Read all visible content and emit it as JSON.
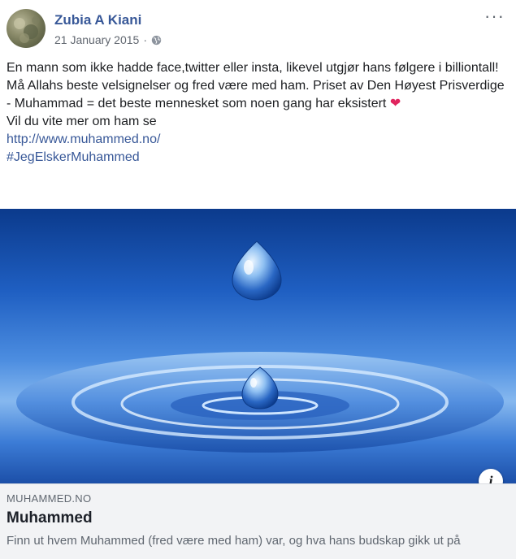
{
  "post": {
    "author": "Zubia A Kiani",
    "date": "21 January 2015",
    "separator": "·",
    "privacy_icon": "globe-icon",
    "more_icon": "more-options-icon",
    "text_line1": "En mann som ikke hadde face,twitter eller insta, likevel utgjør hans følgere i billiontall! Må Allahs beste velsignelser og fred være med ham. Priset av Den Høyest Prisverdige - Muhammad = det beste mennesket som noen gang har eksistert",
    "heart": "❤",
    "text_line2": "Vil du vite mer om ham se",
    "link": "http://www.muhammed.no/",
    "hashtag": "#JegElskerMuhammed"
  },
  "link_card": {
    "image_desc_icon": "water-drop-image",
    "info_label": "i",
    "domain": "MUHAMMED.NO",
    "title": "Muhammed",
    "description": "Finn ut hvem Muhammed (fred være med ham) var, og hva hans budskap gikk ut på"
  },
  "colors": {
    "link": "#385898",
    "heart": "#e0245e",
    "card_bg": "#f2f3f5"
  }
}
